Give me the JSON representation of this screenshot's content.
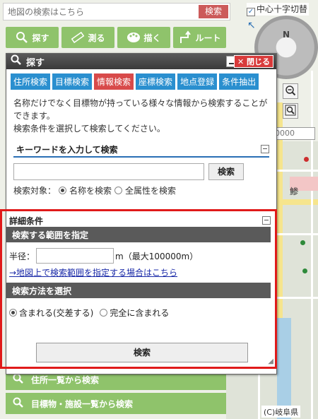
{
  "top_search": {
    "placeholder": "地図の検索はこちら",
    "button": "検索"
  },
  "cross_toggle": {
    "label": "中心十字切替",
    "checked": true
  },
  "tools": [
    {
      "label": "探す",
      "icon": "search-icon"
    },
    {
      "label": "測る",
      "icon": "ruler-icon"
    },
    {
      "label": "描く",
      "icon": "palette-icon"
    },
    {
      "label": "ルート",
      "icon": "route-icon"
    }
  ],
  "compass": {
    "north": "N"
  },
  "scale": {
    "value": "0000"
  },
  "dialog": {
    "title": "探す",
    "close_label": "閉じる",
    "tabs": [
      {
        "label": "住所検索",
        "active": false
      },
      {
        "label": "目標検索",
        "active": false
      },
      {
        "label": "情報検索",
        "active": true
      },
      {
        "label": "座標検索",
        "active": false
      },
      {
        "label": "地点登録",
        "active": false
      },
      {
        "label": "条件抽出",
        "active": false
      }
    ],
    "desc_line1": "名称だけでなく目標物が持っている様々な情報から検索することが",
    "desc_line2": "できます。",
    "desc_line3": "検索条件を選択して検索してください。",
    "keyword_section": "キーワードを入力して検索",
    "keyword_value": "",
    "keyword_button": "検索",
    "target_label": "検索対象：",
    "target_options": [
      "名称を検索",
      "全属性を検索"
    ],
    "target_selected": "名称を検索",
    "detail_title": "詳細条件",
    "range_title": "検索する範囲を指定",
    "radius_label": "半径：",
    "radius_value": "",
    "radius_unit": "m（最大100000m）",
    "map_link": "→地図上で検索範囲を指定する場合はこちら",
    "method_title": "検索方法を選択",
    "method_options": [
      "含まれる(交差する)",
      "完全に含まれる"
    ],
    "method_selected": "含まれる(交差する)",
    "search_button": "検索"
  },
  "left_items": [
    {
      "label": "住所一覧から検索",
      "icon": "search-icon"
    },
    {
      "label": "目標物・施設一覧から検索",
      "icon": "search-icon"
    }
  ],
  "map_label": "鯵",
  "copyright": "(C)岐阜県",
  "colors": {
    "accent_green": "#8fc36b",
    "tab_blue": "#2a8fcf",
    "tab_active": "#d84a4a",
    "highlight_red": "#e01a1a"
  }
}
